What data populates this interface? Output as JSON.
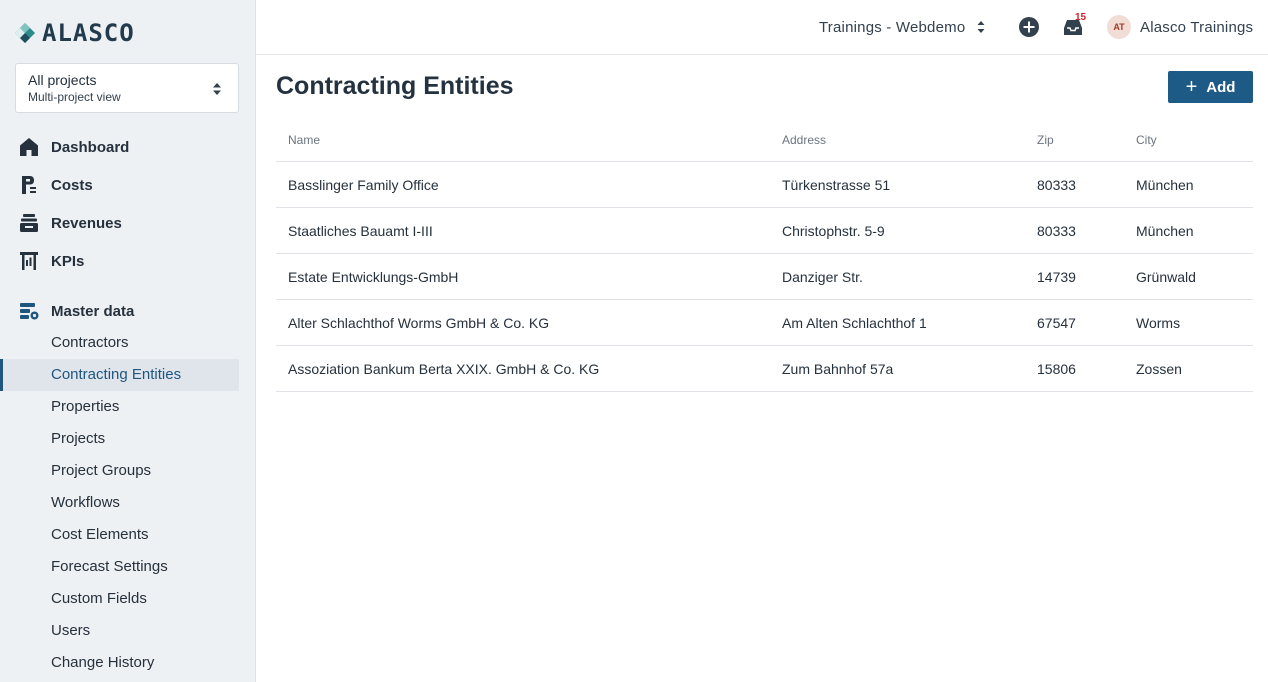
{
  "brand": {
    "name": "ALASCO",
    "accent": "#1d5a85"
  },
  "project_selector": {
    "title": "All projects",
    "subtitle": "Multi-project view"
  },
  "nav": {
    "main": [
      {
        "label": "Dashboard",
        "icon": "home-icon"
      },
      {
        "label": "Costs",
        "icon": "costs-icon"
      },
      {
        "label": "Revenues",
        "icon": "revenues-icon"
      },
      {
        "label": "KPIs",
        "icon": "kpi-chart-icon"
      }
    ],
    "section": {
      "label": "Master data",
      "icon": "master-data-icon"
    },
    "sub": [
      {
        "label": "Contractors"
      },
      {
        "label": "Contracting Entities",
        "active": true
      },
      {
        "label": "Properties"
      },
      {
        "label": "Projects"
      },
      {
        "label": "Project Groups"
      },
      {
        "label": "Workflows"
      },
      {
        "label": "Cost Elements"
      },
      {
        "label": "Forecast Settings"
      },
      {
        "label": "Custom Fields"
      },
      {
        "label": "Users"
      },
      {
        "label": "Change History"
      }
    ]
  },
  "topbar": {
    "tenant": "Trainings - Webdemo",
    "notifications_count": "15",
    "user_initials": "AT",
    "user_name": "Alasco Trainings"
  },
  "page": {
    "title": "Contracting Entities",
    "add_label": "Add"
  },
  "table": {
    "headers": [
      "Name",
      "Address",
      "Zip",
      "City"
    ],
    "rows": [
      [
        "Basslinger Family Office",
        "Türkenstrasse 51",
        "80333",
        "München"
      ],
      [
        "Staatliches Bauamt I-III",
        "Christophstr. 5-9",
        "80333",
        "München"
      ],
      [
        "Estate Entwicklungs-GmbH",
        "Danziger Str.",
        "14739",
        "Grünwald"
      ],
      [
        "Alter Schlachthof Worms GmbH & Co. KG",
        "Am Alten Schlachthof 1",
        "67547",
        "Worms"
      ],
      [
        "Assoziation Bankum Berta XXIX. GmbH & Co. KG",
        "Zum Bahnhof 57a",
        "15806",
        "Zossen"
      ]
    ]
  }
}
